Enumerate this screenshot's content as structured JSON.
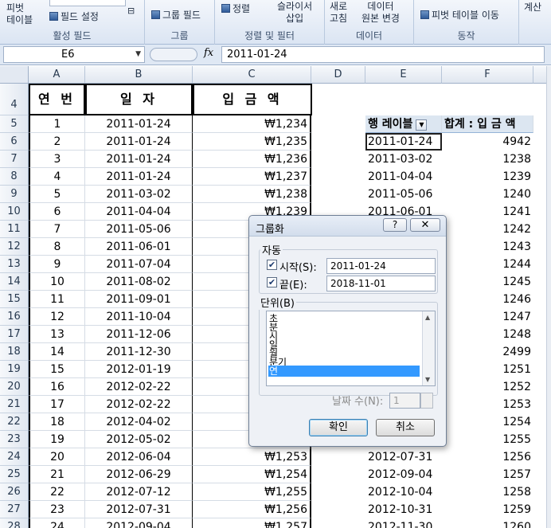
{
  "ribbon": {
    "groups": [
      {
        "label": "활성 필드",
        "buttons": [
          "피벗\n테이블",
          "필드 설정"
        ]
      },
      {
        "label": "그룹",
        "buttons": [
          "그룹 필드"
        ]
      },
      {
        "label": "정렬 및 필터",
        "buttons": [
          "정렬",
          "슬라이서\n삽입"
        ]
      },
      {
        "label": "데이터",
        "buttons": [
          "새로\n고침",
          "데이터\n원본 변경"
        ]
      },
      {
        "label": "동작",
        "buttons": [
          "피벗 테이블 이동"
        ]
      },
      {
        "label": "",
        "buttons": [
          "계산"
        ]
      }
    ],
    "pivot_table_label1": "피벗",
    "pivot_table_label2": "테이블",
    "field_settings": "필드 설정",
    "group_field": "그룹 필드",
    "sort": "정렬",
    "slicer1": "슬라이서",
    "slicer2": "삽입",
    "refresh1": "새로",
    "refresh2": "고침",
    "datasource1": "데이터",
    "datasource2": "원본 변경",
    "move_pivot": "피벗 테이블 이동",
    "calc": "계산",
    "group_active_field": "활성 필드",
    "group_group": "그룹",
    "group_sort_filter": "정렬 및 필터",
    "group_data": "데이터",
    "group_action": "동작"
  },
  "formula_bar": {
    "name_box": "E6",
    "fx": "fx",
    "formula": "2011-01-24"
  },
  "columns": [
    "A",
    "B",
    "C",
    "D",
    "E",
    "F"
  ],
  "rows": [
    "4",
    "5",
    "6",
    "7",
    "8",
    "9",
    "10",
    "11",
    "12",
    "13",
    "14",
    "15",
    "16",
    "17",
    "18",
    "19",
    "20",
    "21",
    "22",
    "23",
    "24",
    "25",
    "26",
    "27",
    "28"
  ],
  "table": {
    "headers": [
      "연 번",
      "일 자",
      "입 금 액"
    ],
    "rows": [
      [
        "1",
        "2011-01-24",
        "₩1,234"
      ],
      [
        "2",
        "2011-01-24",
        "₩1,235"
      ],
      [
        "3",
        "2011-01-24",
        "₩1,236"
      ],
      [
        "4",
        "2011-01-24",
        "₩1,237"
      ],
      [
        "5",
        "2011-03-02",
        "₩1,238"
      ],
      [
        "6",
        "2011-04-04",
        "₩1,239"
      ],
      [
        "7",
        "2011-05-06",
        ""
      ],
      [
        "8",
        "2011-06-01",
        ""
      ],
      [
        "9",
        "2011-07-04",
        ""
      ],
      [
        "10",
        "2011-08-02",
        ""
      ],
      [
        "11",
        "2011-09-01",
        ""
      ],
      [
        "12",
        "2011-10-04",
        ""
      ],
      [
        "13",
        "2011-12-06",
        ""
      ],
      [
        "14",
        "2011-12-30",
        ""
      ],
      [
        "15",
        "2012-01-19",
        ""
      ],
      [
        "16",
        "2012-02-22",
        ""
      ],
      [
        "17",
        "2012-02-22",
        ""
      ],
      [
        "18",
        "2012-04-02",
        ""
      ],
      [
        "19",
        "2012-05-02",
        ""
      ],
      [
        "20",
        "2012-06-04",
        "₩1,253"
      ],
      [
        "21",
        "2012-06-29",
        "₩1,254"
      ],
      [
        "22",
        "2012-07-12",
        "₩1,255"
      ],
      [
        "23",
        "2012-07-31",
        "₩1,256"
      ],
      [
        "24",
        "2012-09-04",
        "₩1,257"
      ]
    ]
  },
  "pivot": {
    "row_label_header": "행 레이블",
    "sum_header": "합계 : 입 금 액",
    "rows": [
      [
        "2011-01-24",
        "4942"
      ],
      [
        "2011-03-02",
        "1238"
      ],
      [
        "2011-04-04",
        "1239"
      ],
      [
        "2011-05-06",
        "1240"
      ],
      [
        "2011-06-01",
        "1241"
      ],
      [
        "",
        "1242"
      ],
      [
        "",
        "1243"
      ],
      [
        "",
        "1244"
      ],
      [
        "",
        "1245"
      ],
      [
        "",
        "1246"
      ],
      [
        "",
        "1247"
      ],
      [
        "",
        "1248"
      ],
      [
        "",
        "2499"
      ],
      [
        "",
        "1251"
      ],
      [
        "",
        "1252"
      ],
      [
        "",
        "1253"
      ],
      [
        "",
        "1254"
      ],
      [
        "",
        "1255"
      ],
      [
        "2012-07-31",
        "1256"
      ],
      [
        "2012-09-04",
        "1257"
      ],
      [
        "2012-10-04",
        "1258"
      ],
      [
        "2012-10-31",
        "1259"
      ],
      [
        "2012-11-30",
        "1260"
      ]
    ]
  },
  "dialog": {
    "title": "그룹화",
    "help": "?",
    "close": "✕",
    "auto_legend": "자동",
    "start_label": "시작(S):",
    "start_value": "2011-01-24",
    "end_label": "끝(E):",
    "end_value": "2018-11-01",
    "unit_legend": "단위(B)",
    "units": [
      "초",
      "분",
      "시",
      "일",
      "월",
      "분기",
      "연"
    ],
    "selected_unit": "연",
    "days_label": "날짜 수(N):",
    "days_value": "1",
    "ok": "확인",
    "cancel": "취소"
  }
}
